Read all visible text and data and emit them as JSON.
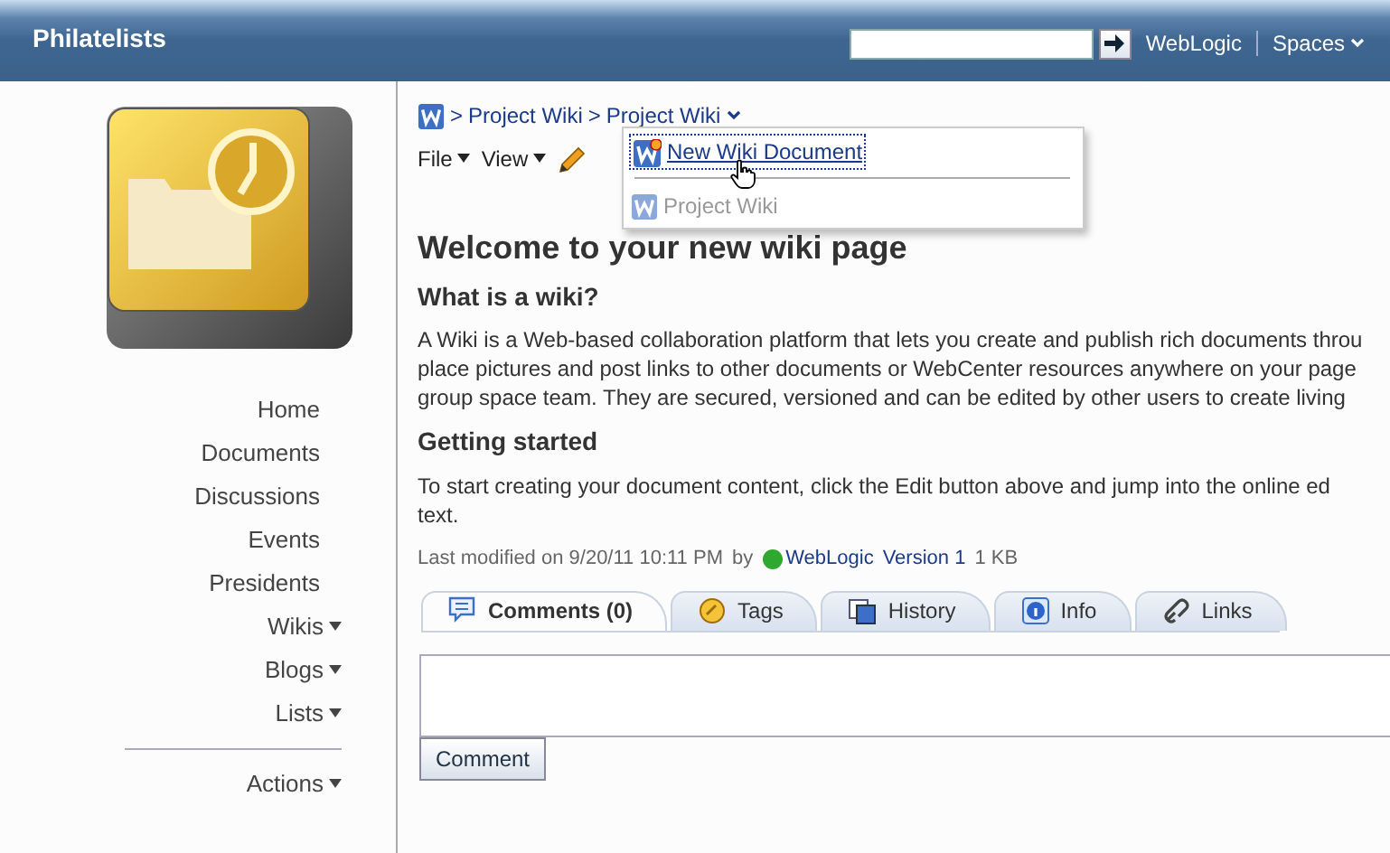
{
  "header": {
    "title": "Philatelists",
    "links": [
      {
        "label": "WebLogic",
        "dropdown": false
      },
      {
        "label": "Spaces",
        "dropdown": true
      }
    ]
  },
  "sidebar": {
    "items": [
      {
        "label": "Home",
        "dropdown": false
      },
      {
        "label": "Documents",
        "dropdown": false
      },
      {
        "label": "Discussions",
        "dropdown": false
      },
      {
        "label": "Events",
        "dropdown": false
      },
      {
        "label": "Presidents",
        "dropdown": false
      },
      {
        "label": "Wikis",
        "dropdown": true
      },
      {
        "label": "Blogs",
        "dropdown": true
      },
      {
        "label": "Lists",
        "dropdown": true
      }
    ],
    "actions": {
      "label": "Actions",
      "dropdown": true
    }
  },
  "breadcrumb": [
    {
      "separator": ">",
      "label": "Project Wiki",
      "dropdown": false
    },
    {
      "separator": ">",
      "label": "Project Wiki",
      "dropdown": true
    }
  ],
  "toolbar": [
    {
      "label": "File"
    },
    {
      "label": "View"
    }
  ],
  "menu": {
    "items": [
      {
        "label": "New Wiki Document",
        "kind": "new",
        "disabled": false,
        "focused": true
      },
      {
        "label": "Project Wiki",
        "kind": "page",
        "disabled": true,
        "focused": false
      }
    ]
  },
  "article": {
    "title": "Welcome to your new wiki page",
    "sections": [
      {
        "heading": "What is a wiki?",
        "lines": [
          "A Wiki is a Web-based collaboration platform that lets you create and publish rich documents throu",
          "place pictures and post links to other documents or WebCenter resources anywhere on your page",
          "group space team. They are secured, versioned and can be edited by other users to create living"
        ]
      },
      {
        "heading": "Getting started",
        "lines": [
          "To start creating your document content, click the Edit button above and jump into the online ed",
          "text."
        ]
      }
    ]
  },
  "meta": {
    "modified": "Last modified on 9/20/11 10:11 PM",
    "by": "by",
    "author": "WebLogic",
    "online": true,
    "version": "Version 1",
    "size": "1 KB"
  },
  "tabs": [
    {
      "label": "Comments (0)",
      "kind": "comment",
      "selected": true
    },
    {
      "label": "Tags",
      "kind": "tag",
      "selected": false
    },
    {
      "label": "History",
      "kind": "history",
      "selected": false
    },
    {
      "label": "Info",
      "kind": "info",
      "selected": false
    },
    {
      "label": "Links",
      "kind": "link",
      "selected": false
    }
  ],
  "comment": {
    "button": "Comment"
  }
}
